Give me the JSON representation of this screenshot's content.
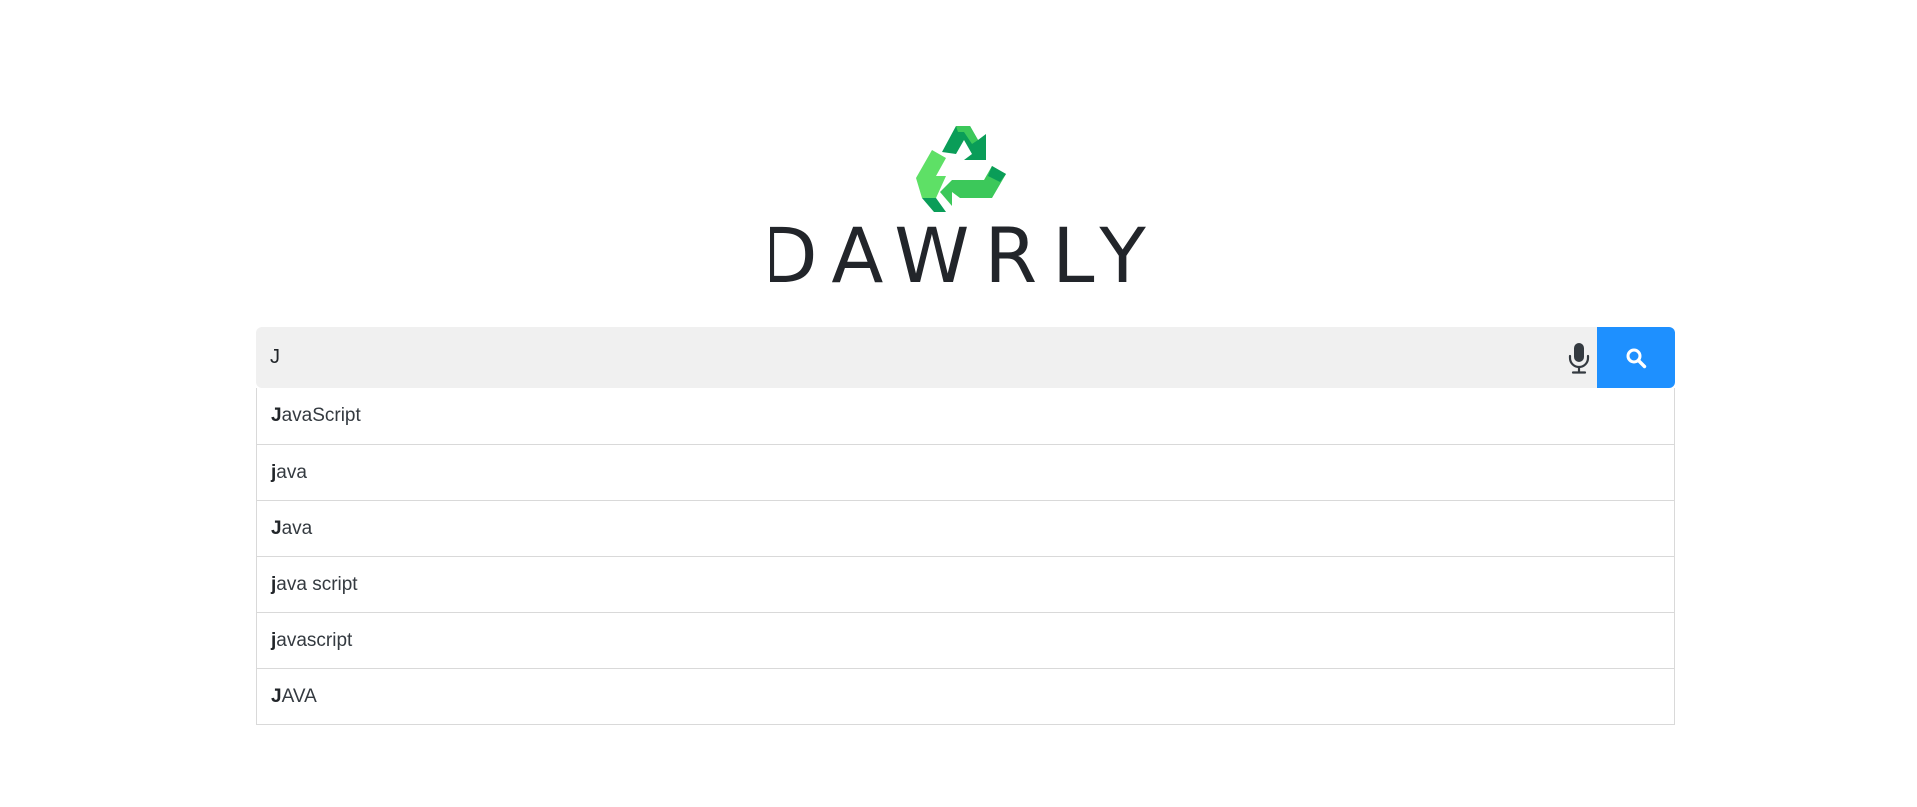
{
  "brand": {
    "name": "DAWRLY",
    "colors": {
      "logo_green_dark": "#0a9d58",
      "logo_green_mid": "#3cc85a",
      "logo_green_light": "#5ee066",
      "wordmark": "#22252a"
    }
  },
  "search": {
    "value": "J",
    "placeholder": "",
    "mic_icon": "microphone-icon",
    "search_icon": "search-icon",
    "button_color": "#1e90ff",
    "input_bg": "#f0f0f0"
  },
  "suggestions": [
    {
      "match": "J",
      "rest": "avaScript"
    },
    {
      "match": "j",
      "rest": "ava"
    },
    {
      "match": "J",
      "rest": "ava"
    },
    {
      "match": "j",
      "rest": "ava script"
    },
    {
      "match": "j",
      "rest": "avascript"
    },
    {
      "match": "J",
      "rest": "AVA"
    }
  ]
}
